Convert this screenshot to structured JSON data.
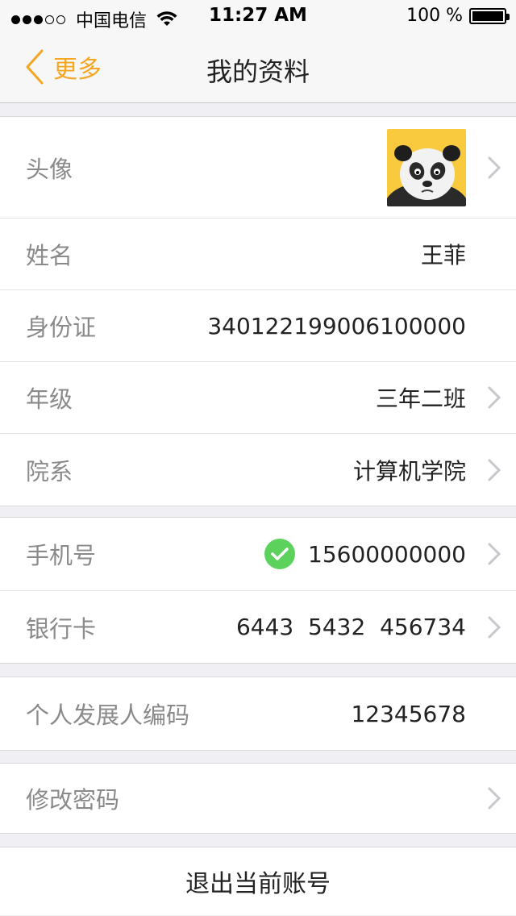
{
  "status_bar": {
    "carrier": "中国电信",
    "time": "11:27 AM",
    "battery": "100 %",
    "battery_level": 1.0
  },
  "nav": {
    "back_label": "更多",
    "title": "我的资料"
  },
  "profile": {
    "avatar_label": "头像",
    "name_label": "姓名",
    "name_value": "王菲",
    "id_label": "身份证",
    "id_value": "340122199006100000",
    "grade_label": "年级",
    "grade_value": "三年二班",
    "dept_label": "院系",
    "dept_value": "计算机学院"
  },
  "contact": {
    "phone_label": "手机号",
    "phone_value": "15600000000",
    "phone_verified": true,
    "bank_label": "银行卡",
    "bank_value": "6443  5432  456734"
  },
  "dev": {
    "code_label": "个人发展人编码",
    "code_value": "12345678"
  },
  "password": {
    "label": "修改密码"
  },
  "logout": {
    "label": "退出当前账号"
  },
  "colors": {
    "accent": "#f5a623",
    "verified": "#5cd25c",
    "label_gray": "#8a8a8a"
  }
}
